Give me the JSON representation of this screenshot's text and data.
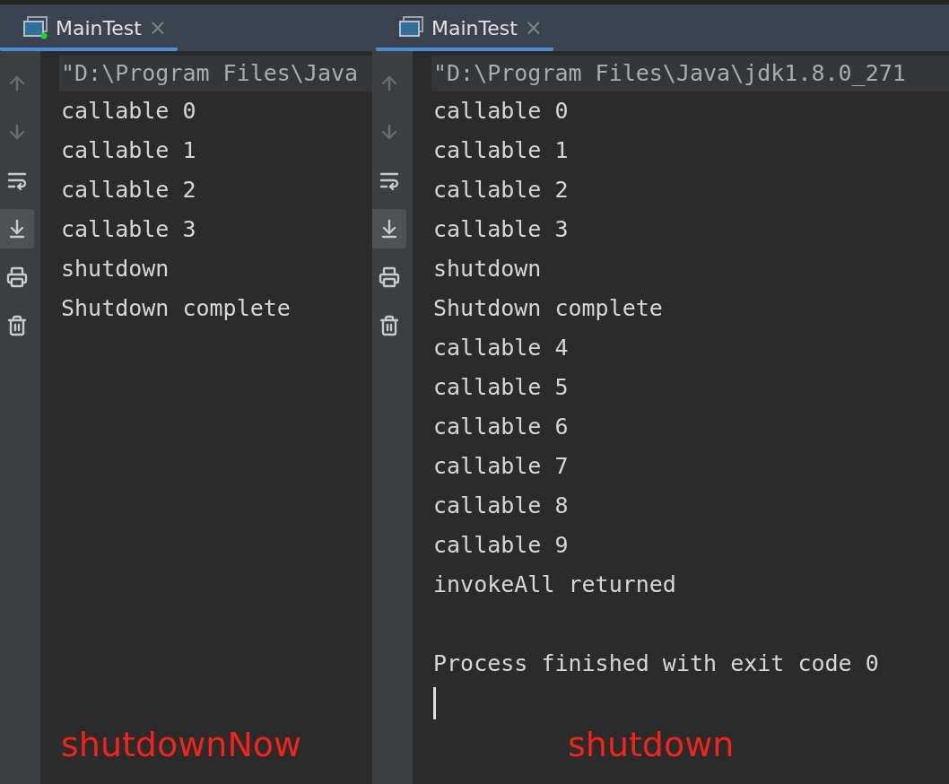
{
  "panels": [
    {
      "tab": {
        "label": "MainTest",
        "close": "×",
        "running": true,
        "selected": true
      },
      "tools": [
        {
          "kind": "up",
          "disabled": true,
          "selected": false
        },
        {
          "kind": "down",
          "disabled": true,
          "selected": false
        },
        {
          "kind": "wrap",
          "disabled": false,
          "selected": false
        },
        {
          "kind": "scroll-end",
          "disabled": false,
          "selected": true
        },
        {
          "kind": "print",
          "disabled": false,
          "selected": false
        },
        {
          "kind": "trash",
          "disabled": false,
          "selected": false
        }
      ],
      "command": "\"D:\\Program Files\\Java",
      "lines": [
        "callable 0",
        "callable 1",
        "callable 2",
        "callable 3",
        "shutdown",
        "Shutdown complete"
      ],
      "caption": "shutdownNow"
    },
    {
      "tab": {
        "label": "MainTest",
        "close": "×",
        "running": false,
        "selected": true
      },
      "tools": [
        {
          "kind": "up",
          "disabled": true,
          "selected": false
        },
        {
          "kind": "down",
          "disabled": true,
          "selected": false
        },
        {
          "kind": "wrap",
          "disabled": false,
          "selected": false
        },
        {
          "kind": "scroll-end",
          "disabled": false,
          "selected": true
        },
        {
          "kind": "print",
          "disabled": false,
          "selected": false
        },
        {
          "kind": "trash",
          "disabled": false,
          "selected": false
        }
      ],
      "command": "\"D:\\Program Files\\Java\\jdk1.8.0_271",
      "lines": [
        "callable 0",
        "callable 1",
        "callable 2",
        "callable 3",
        "shutdown",
        "Shutdown complete",
        "callable 4",
        "callable 5",
        "callable 6",
        "callable 7",
        "callable 8",
        "callable 9",
        "invokeAll returned"
      ],
      "exit_message": "Process finished with exit code 0",
      "cursor": true,
      "caption": "shutdown"
    }
  ]
}
